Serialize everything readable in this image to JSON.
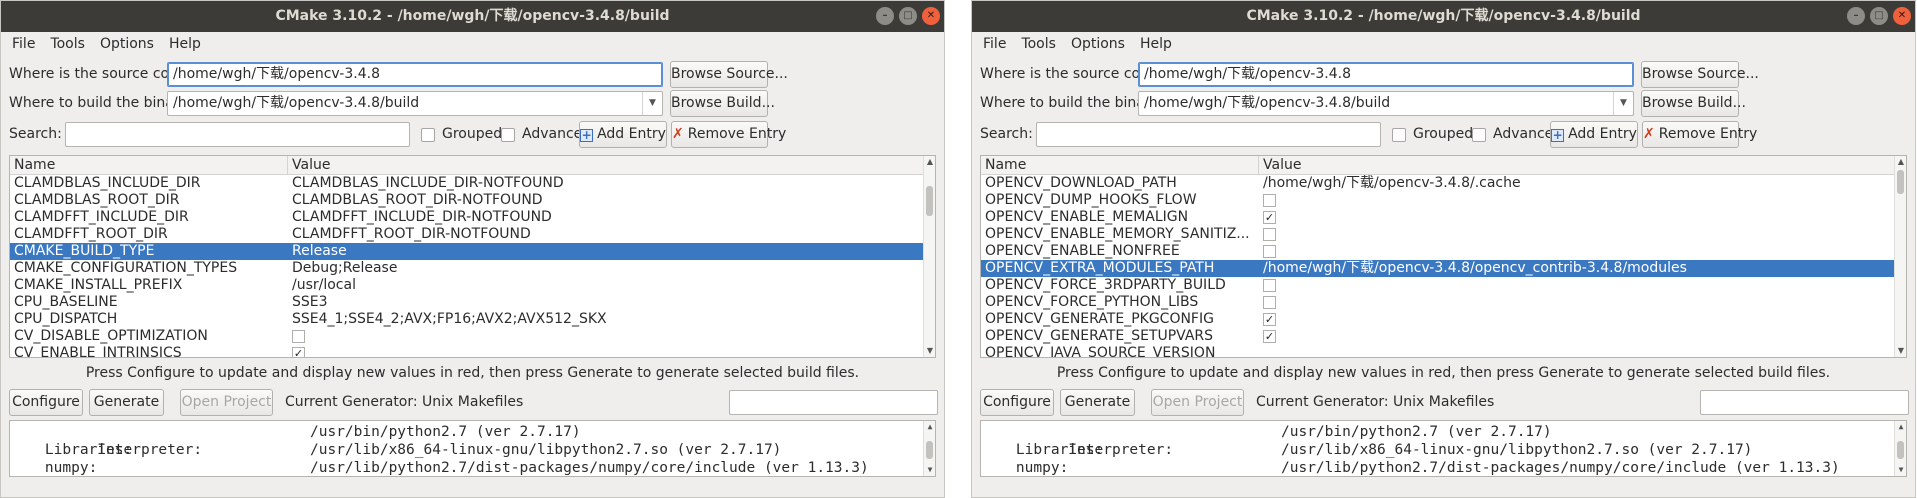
{
  "windows": [
    {
      "title": "CMake 3.10.2 - /home/wgh/下载/opencv-3.4.8/build",
      "menu": [
        "File",
        "Tools",
        "Options",
        "Help"
      ],
      "source_label": "Where is the source code:",
      "source_value": "/home/wgh/下载/opencv-3.4.8",
      "browse_source": "Browse Source...",
      "build_label": "Where to build the binaries:",
      "build_value": "/home/wgh/下载/opencv-3.4.8/build",
      "browse_build": "Browse Build...",
      "search_label": "Search:",
      "grouped": "Grouped",
      "advanced": "Advanced",
      "add_entry": "Add Entry",
      "remove_entry": "Remove Entry",
      "col_name": "Name",
      "col_value": "Value",
      "rows": [
        {
          "name": "CLAMDBLAS_INCLUDE_DIR",
          "value": "CLAMDBLAS_INCLUDE_DIR-NOTFOUND"
        },
        {
          "name": "CLAMDBLAS_ROOT_DIR",
          "value": "CLAMDBLAS_ROOT_DIR-NOTFOUND"
        },
        {
          "name": "CLAMDFFT_INCLUDE_DIR",
          "value": "CLAMDFFT_INCLUDE_DIR-NOTFOUND"
        },
        {
          "name": "CLAMDFFT_ROOT_DIR",
          "value": "CLAMDFFT_ROOT_DIR-NOTFOUND"
        },
        {
          "name": "CMAKE_BUILD_TYPE",
          "value": "Release",
          "selected": true
        },
        {
          "name": "CMAKE_CONFIGURATION_TYPES",
          "value": "Debug;Release"
        },
        {
          "name": "CMAKE_INSTALL_PREFIX",
          "value": "/usr/local"
        },
        {
          "name": "CPU_BASELINE",
          "value": "SSE3"
        },
        {
          "name": "CPU_DISPATCH",
          "value": "SSE4_1;SSE4_2;AVX;FP16;AVX2;AVX512_SKX"
        },
        {
          "name": "CV_DISABLE_OPTIMIZATION",
          "check": ""
        },
        {
          "name": "CV_ENABLE_INTRINSICS",
          "check": "✓"
        }
      ],
      "hint": "Press Configure to update and display new values in red, then press Generate to generate selected build files.",
      "configure": "Configure",
      "generate": "Generate",
      "open_project": "Open Project",
      "generator": "Current Generator: Unix Makefiles",
      "output": [
        {
          "key": "    Interpreter:",
          "val": "/usr/bin/python2.7 (ver 2.7.17)"
        },
        {
          "key": "    Libraries:",
          "val": "/usr/lib/x86_64-linux-gnu/libpython2.7.so (ver 2.7.17)"
        },
        {
          "key": "    numpy:",
          "val": "/usr/lib/python2.7/dist-packages/numpy/core/include (ver 1.13.3)"
        }
      ]
    },
    {
      "title": "CMake 3.10.2 - /home/wgh/下载/opencv-3.4.8/build",
      "menu": [
        "File",
        "Tools",
        "Options",
        "Help"
      ],
      "source_label": "Where is the source code:",
      "source_value": "/home/wgh/下载/opencv-3.4.8",
      "browse_source": "Browse Source...",
      "build_label": "Where to build the binaries:",
      "build_value": "/home/wgh/下载/opencv-3.4.8/build",
      "browse_build": "Browse Build...",
      "search_label": "Search:",
      "grouped": "Grouped",
      "advanced": "Advanced",
      "add_entry": "Add Entry",
      "remove_entry": "Remove Entry",
      "col_name": "Name",
      "col_value": "Value",
      "rows": [
        {
          "name": "OPENCV_DOWNLOAD_PATH",
          "value": "/home/wgh/下载/opencv-3.4.8/.cache"
        },
        {
          "name": "OPENCV_DUMP_HOOKS_FLOW",
          "check": ""
        },
        {
          "name": "OPENCV_ENABLE_MEMALIGN",
          "check": "✓"
        },
        {
          "name": "OPENCV_ENABLE_MEMORY_SANITIZ...",
          "check": ""
        },
        {
          "name": "OPENCV_ENABLE_NONFREE",
          "check": ""
        },
        {
          "name": "OPENCV_EXTRA_MODULES_PATH",
          "value": "/home/wgh/下载/opencv-3.4.8/opencv_contrib-3.4.8/modules",
          "selected": true
        },
        {
          "name": "OPENCV_FORCE_3RDPARTY_BUILD",
          "check": ""
        },
        {
          "name": "OPENCV_FORCE_PYTHON_LIBS",
          "check": ""
        },
        {
          "name": "OPENCV_GENERATE_PKGCONFIG",
          "check": "✓"
        },
        {
          "name": "OPENCV_GENERATE_SETUPVARS",
          "check": "✓"
        },
        {
          "name": "OPENCV_JAVA_SOURCE_VERSION",
          "value": ""
        }
      ],
      "hint": "Press Configure to update and display new values in red, then press Generate to generate selected build files.",
      "configure": "Configure",
      "generate": "Generate",
      "open_project": "Open Project",
      "generator": "Current Generator: Unix Makefiles",
      "output": [
        {
          "key": "    Interpreter:",
          "val": "/usr/bin/python2.7 (ver 2.7.17)"
        },
        {
          "key": "    Libraries:",
          "val": "/usr/lib/x86_64-linux-gnu/libpython2.7.so (ver 2.7.17)"
        },
        {
          "key": "    numpy:",
          "val": "/usr/lib/python2.7/dist-packages/numpy/core/include (ver 1.13.3)"
        }
      ]
    }
  ]
}
